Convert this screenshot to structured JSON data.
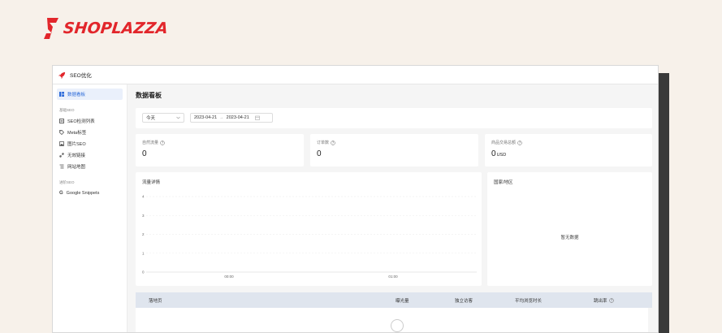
{
  "brand": {
    "name": "SHOPLAZZA",
    "color": "#e2262b"
  },
  "window": {
    "title": "SEO优化"
  },
  "sidebar": {
    "dashboard": "数据看板",
    "group_basic": "基础SEO",
    "basic_items": [
      "SEO检测列表",
      "Meta标签",
      "图片SEO",
      "无效链接",
      "网站地图"
    ],
    "group_advanced": "进阶SEO",
    "advanced_items": [
      "Google Snippets"
    ]
  },
  "main": {
    "title": "数据看板",
    "filter": {
      "period": "今天",
      "date_start": "2023-04-21",
      "date_end": "2023-04-21",
      "separator": "→"
    },
    "stats": [
      {
        "label": "自然流量",
        "value": "0",
        "unit": ""
      },
      {
        "label": "订单数",
        "value": "0",
        "unit": ""
      },
      {
        "label": "商品交易总额",
        "value": "0",
        "unit": "USD"
      }
    ],
    "traffic_card": {
      "title": "流量详情"
    },
    "country_card": {
      "title": "国家/地区",
      "empty": "暂无数据"
    },
    "table": {
      "columns": [
        "落地页",
        "曝光量",
        "独立访客",
        "平均浏览时长",
        "跳出率"
      ]
    }
  },
  "chart_data": {
    "type": "line",
    "title": "流量详情",
    "x": [
      "00:00",
      "01:00"
    ],
    "yticks": [
      0,
      1,
      2,
      3,
      4
    ],
    "ylim": [
      0,
      4
    ],
    "series": [],
    "grid": true
  }
}
